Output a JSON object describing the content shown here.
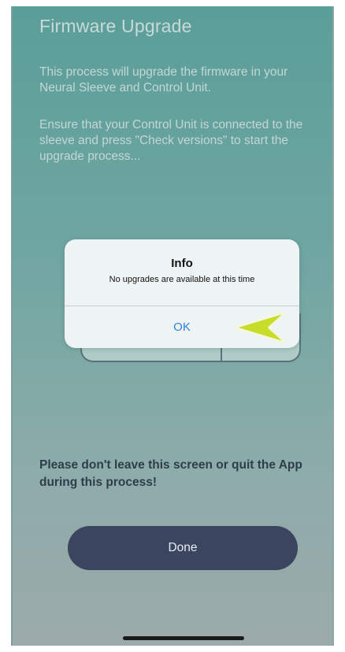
{
  "screen": {
    "title": "Firmware Upgrade",
    "intro": "This process will upgrade the firmware in your Neural Sleeve and Control Unit.",
    "instructions": "Ensure that your Control Unit is connected to the sleeve and press \"Check versions\" to start the upgrade process...",
    "warning": "Please don't leave this screen or quit the App during this process!",
    "done_label": "Done"
  },
  "alert": {
    "title": "Info",
    "message": "No upgrades are available at this time",
    "ok_label": "OK"
  },
  "colors": {
    "background_top": "#5fa8a2",
    "background_bottom": "#a9b5b6",
    "done_button": "#3b4560",
    "ok_link": "#2f7ee6",
    "pointer_arrow": "#c8dc2a"
  }
}
